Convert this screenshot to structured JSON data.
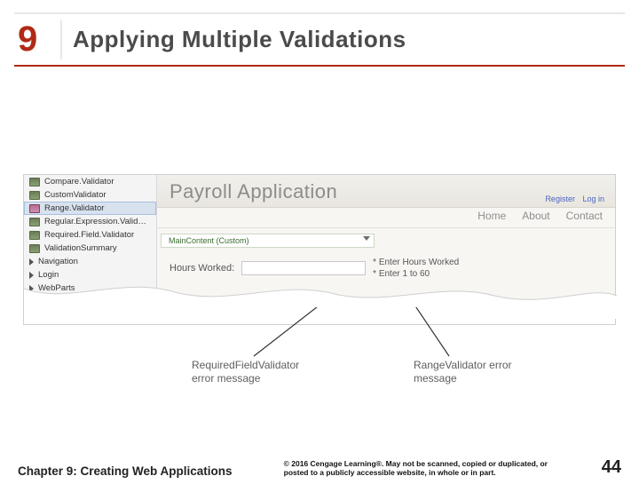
{
  "header": {
    "chapter_number": "9",
    "title": "Applying Multiple Validations"
  },
  "toolbox": {
    "items": [
      "Compare.Validator",
      "CustomValidator",
      "Range.Validator",
      "Regular.Expression.Valid…",
      "Required.Field.Validator",
      "ValidationSummary"
    ],
    "groups": [
      "Navigation",
      "Login",
      "WebParts"
    ]
  },
  "preview": {
    "app_title": "Payroll Application",
    "auth_links": [
      "Register",
      "Log in"
    ],
    "nav_items": [
      "Home",
      "About",
      "Contact"
    ],
    "content_tag": "MainContent (Custom)",
    "form_label": "Hours Worked:",
    "messages": [
      "* Enter Hours Worked",
      "* Enter 1 to 60"
    ]
  },
  "callouts": {
    "left": "RequiredFieldValidator error message",
    "right": "RangeValidator error message"
  },
  "footer": {
    "chapter_line": "Chapter 9: Creating Web Applications",
    "copyright": "© 2016 Cengage Learning®. May not be scanned, copied or duplicated, or posted to a publicly accessible website, in whole or in part.",
    "page": "44"
  }
}
